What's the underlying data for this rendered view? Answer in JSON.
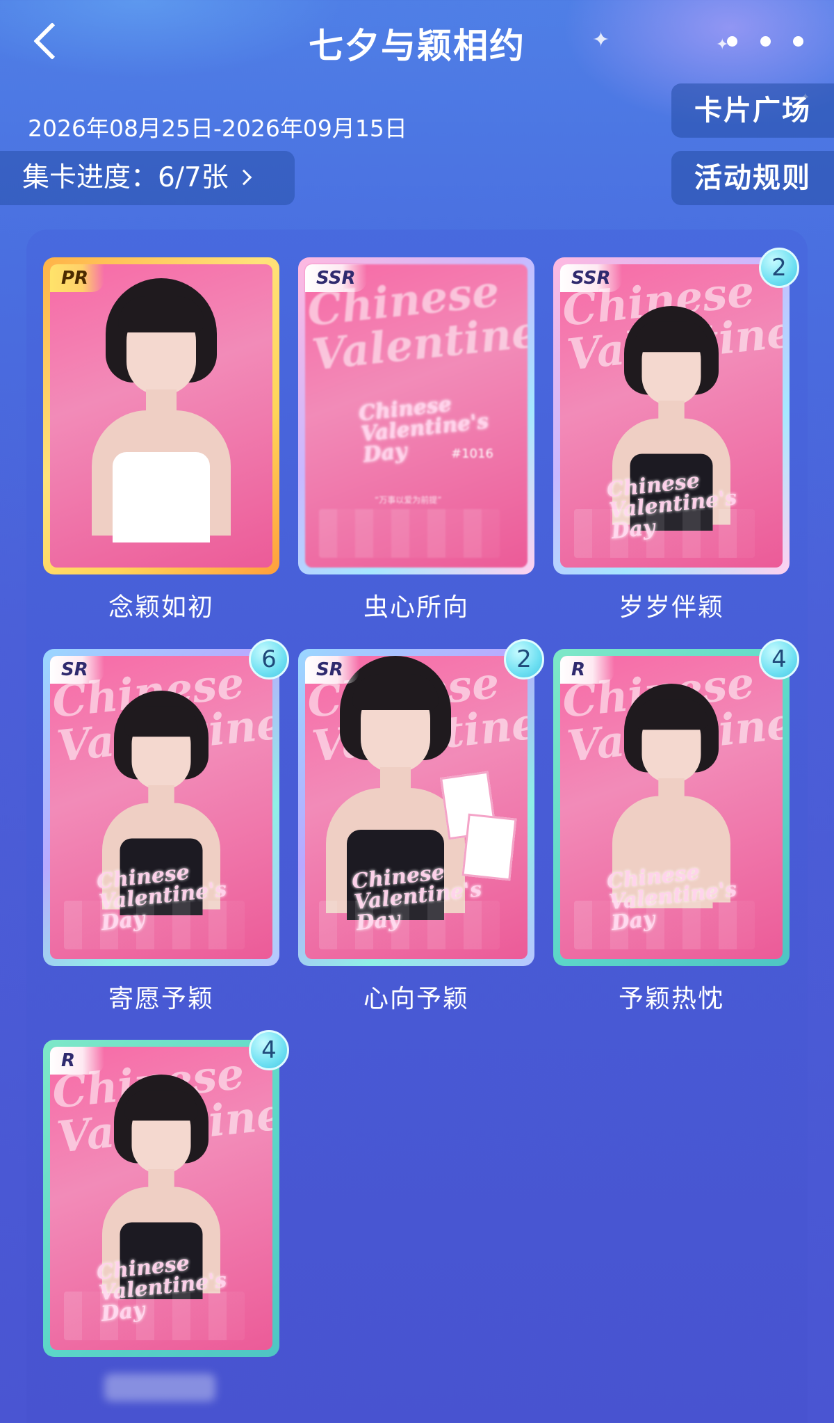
{
  "header": {
    "title": "七夕与颖相约",
    "back_icon": "chevron-left-icon",
    "more_icon": "more-dots-icon"
  },
  "event": {
    "date_range": "2026年08月25日-2026年09月15日",
    "progress_label": "集卡进度：6/7张"
  },
  "actions": {
    "card_square": "卡片广场",
    "rules": "活动规则"
  },
  "cards": [
    {
      "name": "念颖如初",
      "rarity": "PR",
      "count": ""
    },
    {
      "name": "虫心所向",
      "rarity": "SSR",
      "count": ""
    },
    {
      "name": "岁岁伴颖",
      "rarity": "SSR",
      "count": "2"
    },
    {
      "name": "寄愿予颖",
      "rarity": "SR",
      "count": "6"
    },
    {
      "name": "心向予颖",
      "rarity": "SR",
      "count": "2"
    },
    {
      "name": "予颖热忱",
      "rarity": "R",
      "count": "4"
    },
    {
      "name": "",
      "rarity": "R",
      "count": "4"
    }
  ],
  "card_art": {
    "script_text": "Chinese Valentine",
    "small_text": "Chinese Valentine's Day",
    "tag": "#1016",
    "locked_caption": "“万事以爱为前提”"
  },
  "colors": {
    "bg_top": "#4f7fe6",
    "bg_bottom": "#4a55d2",
    "card_pink": "#f76aa6",
    "badge": "#6fe0f2"
  }
}
